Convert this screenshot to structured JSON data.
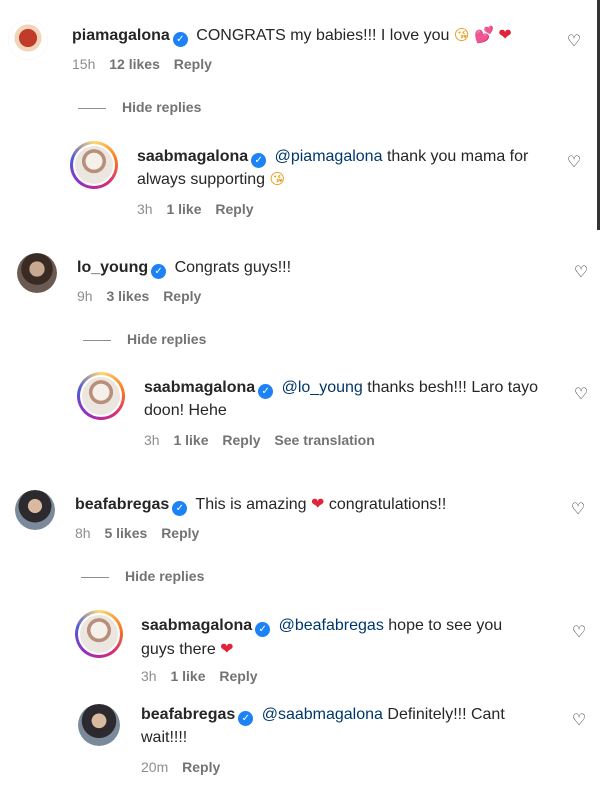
{
  "threads": [
    {
      "user": "piamagalona",
      "verified_icon": "✓",
      "text": "CONGRATS my babies!!! I love you",
      "emojis": [
        "😘",
        "💕",
        "❤"
      ],
      "time": "15h",
      "likes": "12 likes",
      "reply": "Reply",
      "hide_replies": "Hide replies",
      "replies": [
        {
          "user": "saabmagalona",
          "verified_icon": "✓",
          "mention": "@piamagalona",
          "text_line1": "thank you mama for",
          "text_line2": "always supporting",
          "emoji": "😘",
          "time": "3h",
          "likes": "1 like",
          "reply": "Reply"
        }
      ]
    },
    {
      "user": "lo_young",
      "verified_icon": "✓",
      "text": "Congrats guys!!!",
      "time": "9h",
      "likes": "3 likes",
      "reply": "Reply",
      "hide_replies": "Hide replies",
      "replies": [
        {
          "user": "saabmagalona",
          "verified_icon": "✓",
          "mention": "@lo_young",
          "text_line1": "thanks besh!!! Laro tayo",
          "text_line2": "doon! Hehe",
          "time": "3h",
          "likes": "1 like",
          "reply": "Reply",
          "see_translation": "See translation"
        }
      ]
    },
    {
      "user": "beafabregas",
      "verified_icon": "✓",
      "text_before": "This is amazing",
      "heart": "❤",
      "text_after": "congratulations!!",
      "time": "8h",
      "likes": "5 likes",
      "reply": "Reply",
      "hide_replies": "Hide replies",
      "replies": [
        {
          "user": "saabmagalona",
          "verified_icon": "✓",
          "mention": "@beafabregas",
          "text_line1": "hope to see you",
          "text_line2": "guys there",
          "heart": "❤",
          "time": "3h",
          "likes": "1 like",
          "reply": "Reply"
        },
        {
          "user": "beafabregas",
          "verified_icon": "✓",
          "mention": "@saabmagalona",
          "text_line1": "Definitely!!! Cant",
          "text_line2": "wait!!!!",
          "time": "20m",
          "reply": "Reply"
        }
      ]
    }
  ],
  "icons": {
    "like": "heart-outline-icon",
    "like_glyph": "♡"
  },
  "colors": {
    "verified": "#1d82f5",
    "mention": "#00376b",
    "heart": "#e0243a",
    "meta": "#8e8e8e"
  }
}
